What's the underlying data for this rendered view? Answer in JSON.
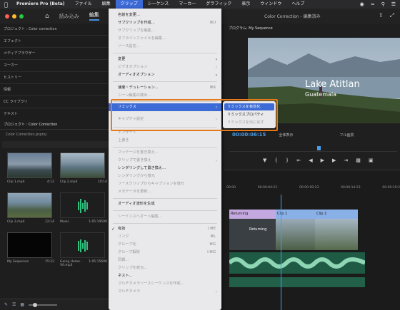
{
  "menubar": {
    "app": "Premiere Pro (Beta)",
    "items": [
      "ファイル",
      "編集",
      "クリップ",
      "シーケンス",
      "マーカー",
      "グラフィック",
      "表示",
      "ウィンドウ",
      "ヘルプ"
    ]
  },
  "header": {
    "tabs": [
      "読み込み",
      "編集"
    ],
    "title": "Color Correction - 編集済み"
  },
  "left_panels": [
    "プロジェクト : Color correction",
    "エフェクト",
    "メディアブラウザー",
    "マーカー",
    "ヒストリー",
    "情報",
    "CC ライブラリ",
    "テキスト"
  ],
  "project": {
    "title": "プロジェクト : Color Correction",
    "folder": "Color Correction.prproj",
    "items": [
      {
        "name": "Clip 1.mp4",
        "dur": "4:12"
      },
      {
        "name": "Clip 2.mp4",
        "dur": "10:14"
      },
      {
        "name": "Clip 3.mp4",
        "dur": "12:14"
      },
      {
        "name": "Music",
        "dur": "1:05:19599"
      },
      {
        "name": "My Sequence",
        "dur": "15:22"
      },
      {
        "name": "Going Home - V0.mp3",
        "dur": "1:05:15608"
      }
    ]
  },
  "monitor": {
    "title": "プログラム: My Sequence",
    "overlay_title": "Lake Atitlan",
    "overlay_sub": "Guatemala",
    "timecode": "00:00:06:15",
    "fit": "全体表示",
    "quality": "フル画質"
  },
  "timeline": {
    "ticks": [
      "00:00",
      "00:00:04:23",
      "00:00:09:23",
      "00:00:14:23",
      "00:00:19:2"
    ],
    "clips": {
      "c1": "Returning",
      "c2": "Clip 1",
      "c3": "Clip 2",
      "returning": "Returning"
    }
  },
  "clip_menu": {
    "items": [
      {
        "label": "名前を変更...",
        "state": "enabled"
      },
      {
        "label": "サブクリップを作成...",
        "state": "enabled",
        "shortcut": "⌘U"
      },
      {
        "label": "サブクリップを編集...",
        "state": "disabled"
      },
      {
        "label": "オフラインファイルを編集...",
        "state": "disabled"
      },
      {
        "label": "ソース設定...",
        "state": "disabled"
      },
      {
        "label": "変更",
        "state": "enabled",
        "submenu": true
      },
      {
        "label": "ビデオオプション",
        "state": "disabled",
        "submenu": true
      },
      {
        "label": "オーディオオプション",
        "state": "enabled",
        "submenu": true
      },
      {
        "label": "速度・デュレーション...",
        "state": "enabled",
        "shortcut": "⌘R"
      },
      {
        "label": "シーン編集の検出...",
        "state": "disabled"
      },
      {
        "label": "リミックス",
        "state": "selected",
        "submenu": true
      },
      {
        "label": "キャプチャ設定",
        "state": "disabled",
        "submenu": true
      },
      {
        "label": "インサート",
        "state": "disabled"
      },
      {
        "label": "上書き",
        "state": "disabled"
      },
      {
        "label": "フッテージを置き換え...",
        "state": "disabled"
      },
      {
        "label": "クリップで置き換え",
        "state": "disabled",
        "submenu": true
      },
      {
        "label": "レンダリングして置き換え...",
        "state": "enabled"
      },
      {
        "label": "レンダリングから復元",
        "state": "disabled"
      },
      {
        "label": "ソースクリップからキャプションを復元",
        "state": "disabled"
      },
      {
        "label": "メタデータを更新...",
        "state": "disabled"
      },
      {
        "label": "オーディオ波形を生成",
        "state": "enabled"
      },
      {
        "label": "シーケンスへオート編集...",
        "state": "disabled"
      },
      {
        "label": "有効",
        "state": "enabled",
        "checked": true,
        "shortcut": "⇧⌘E"
      },
      {
        "label": "リンク",
        "state": "disabled",
        "shortcut": "⌘L"
      },
      {
        "label": "グループ化",
        "state": "disabled",
        "shortcut": "⌘G"
      },
      {
        "label": "グループ解除",
        "state": "disabled",
        "shortcut": "⇧⌘G"
      },
      {
        "label": "同期...",
        "state": "disabled"
      },
      {
        "label": "クリップを統合...",
        "state": "disabled"
      },
      {
        "label": "ネスト...",
        "state": "enabled"
      },
      {
        "label": "マルチカメラソースシーケンスを作成...",
        "state": "disabled"
      },
      {
        "label": "マルチカメラ",
        "state": "disabled",
        "submenu": true
      }
    ]
  },
  "remix_submenu": {
    "items": [
      {
        "label": "リミックスを有効化",
        "state": "selected"
      },
      {
        "label": "リミックスプロパティ",
        "state": "enabled"
      },
      {
        "label": "リミックスを元に戻す",
        "state": "disabled"
      }
    ]
  },
  "colors": {
    "highlight": "#3c6ad6",
    "annotation": "#e57a1b",
    "timecode": "#4a9ce8"
  }
}
